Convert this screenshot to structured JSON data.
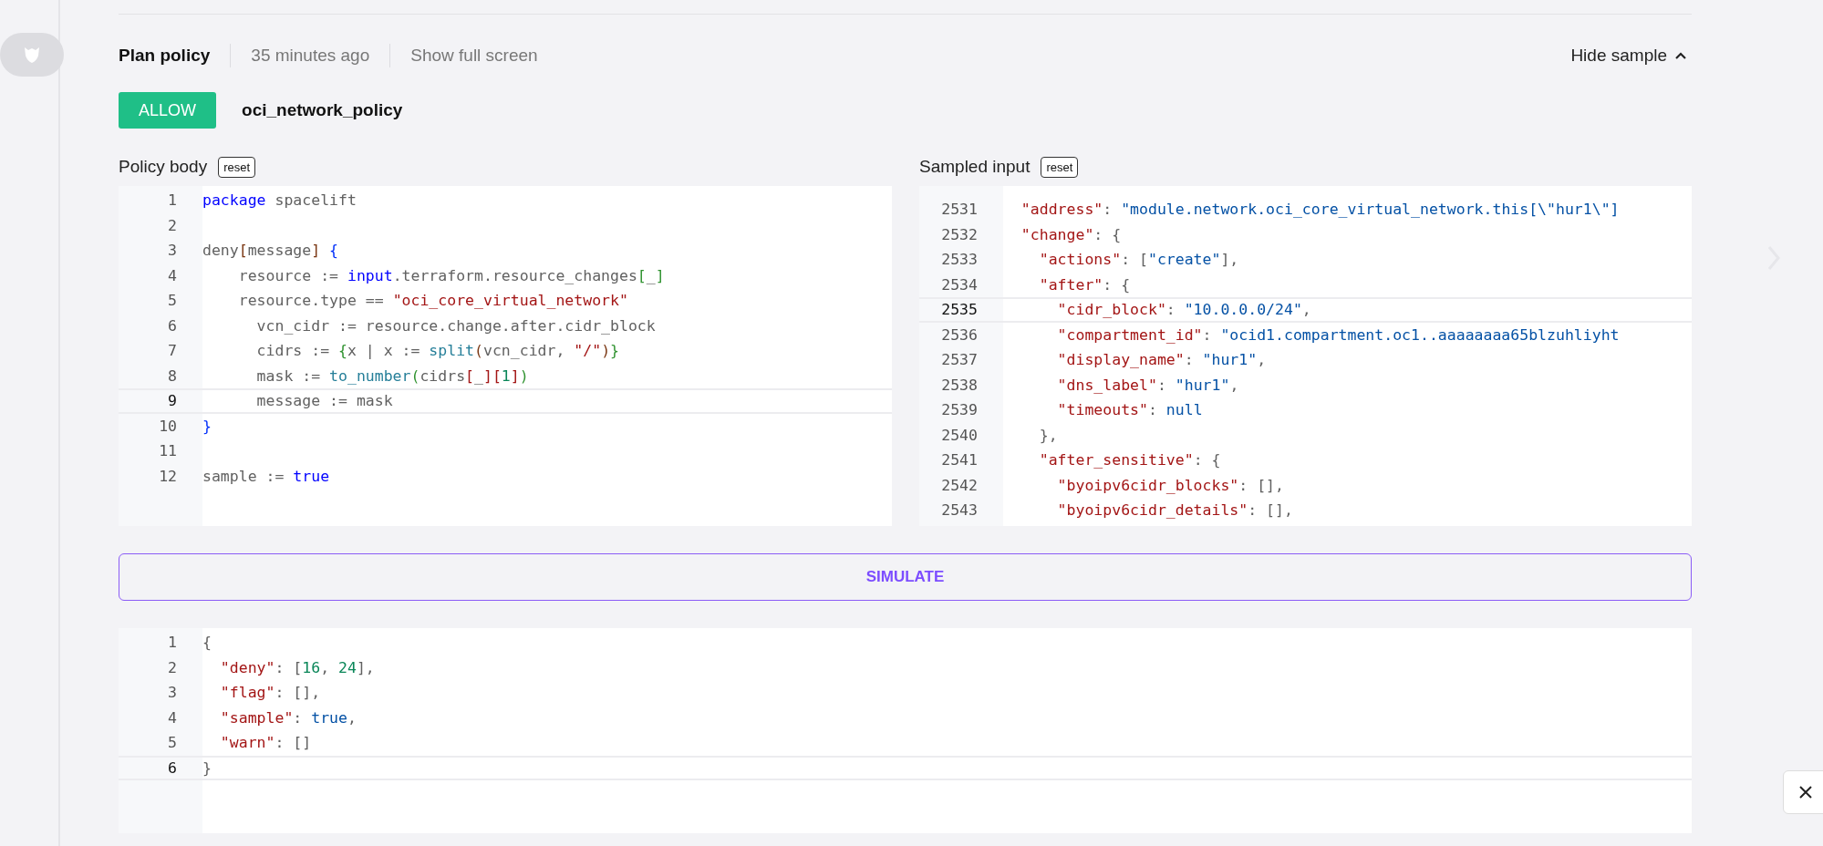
{
  "header": {
    "title": "Plan policy",
    "time": "35 minutes ago",
    "fullscreen_link": "Show full screen",
    "toggle": "Hide sample"
  },
  "decision": {
    "badge": "ALLOW",
    "policy_name": "oci_network_policy"
  },
  "policy_body": {
    "label": "Policy body",
    "reset": "reset",
    "lines": [
      {
        "n": "1",
        "active": false,
        "tokens": [
          {
            "kind": "kw",
            "text": "package"
          },
          {
            "kind": "plain",
            "text": " spacelift"
          }
        ]
      },
      {
        "n": "2",
        "active": false
      },
      {
        "n": "3",
        "active": false,
        "tokens": [
          {
            "kind": "plain",
            "text": "deny"
          },
          {
            "kind": "br3",
            "text": "["
          },
          {
            "kind": "plain",
            "text": "message"
          },
          {
            "kind": "br3",
            "text": "]"
          },
          {
            "kind": "br1",
            "text": " {"
          }
        ]
      },
      {
        "n": "4",
        "active": false,
        "tokens": [
          {
            "kind": "plain",
            "text": "    resource := "
          },
          {
            "kind": "kw",
            "text": "input"
          },
          {
            "kind": "plain",
            "text": ".terraform.resource_changes"
          },
          {
            "kind": "br2",
            "text": "["
          },
          {
            "kind": "plain",
            "text": "_"
          },
          {
            "kind": "br2",
            "text": "]"
          }
        ]
      },
      {
        "n": "5",
        "active": false,
        "tokens": [
          {
            "kind": "plain",
            "text": "    resource.type == "
          },
          {
            "kind": "str",
            "text": "\"oci_core_virtual_network\""
          }
        ]
      },
      {
        "n": "6",
        "active": false,
        "tokens": [
          {
            "kind": "plain",
            "text": "      vcn_cidr := resource.change.after.cidr_block"
          }
        ]
      },
      {
        "n": "7",
        "active": false,
        "tokens": [
          {
            "kind": "plain",
            "text": "      cidrs := "
          },
          {
            "kind": "br2",
            "text": "{"
          },
          {
            "kind": "plain",
            "text": "x | x := "
          },
          {
            "kind": "fn",
            "text": "split"
          },
          {
            "kind": "br3",
            "text": "("
          },
          {
            "kind": "plain",
            "text": "vcn_cidr, "
          },
          {
            "kind": "str",
            "text": "\"/\""
          },
          {
            "kind": "br3",
            "text": ")"
          },
          {
            "kind": "br2",
            "text": "}"
          }
        ]
      },
      {
        "n": "8",
        "active": false,
        "tokens": [
          {
            "kind": "plain",
            "text": "      mask := "
          },
          {
            "kind": "fn",
            "text": "to_number"
          },
          {
            "kind": "br2",
            "text": "("
          },
          {
            "kind": "plain",
            "text": "cidrs"
          },
          {
            "kind": "str",
            "text": "["
          },
          {
            "kind": "plain",
            "text": "_"
          },
          {
            "kind": "str",
            "text": "]["
          },
          {
            "kind": "num",
            "text": "1"
          },
          {
            "kind": "str",
            "text": "]"
          },
          {
            "kind": "br2",
            "text": ")"
          }
        ]
      },
      {
        "n": "9",
        "active": true,
        "tokens": [
          {
            "kind": "plain",
            "text": "      message := mask"
          }
        ]
      },
      {
        "n": "10",
        "active": false,
        "tokens": [
          {
            "kind": "br1",
            "text": "}"
          }
        ]
      },
      {
        "n": "11",
        "active": false
      },
      {
        "n": "12",
        "active": false,
        "tokens": [
          {
            "kind": "plain",
            "text": "sample := "
          },
          {
            "kind": "kw",
            "text": "true"
          }
        ]
      }
    ]
  },
  "sampled_input": {
    "label": "Sampled input",
    "reset": "reset",
    "lines": [
      {
        "n": "2531",
        "active": false,
        "tokens": [
          {
            "kind": "key",
            "text": "  \"address\""
          },
          {
            "kind": "plain",
            "text": ": "
          },
          {
            "kind": "val",
            "text": "\"module.network.oci_core_virtual_network.this[\\\"hur1\\\"]"
          }
        ]
      },
      {
        "n": "2532",
        "active": false,
        "tokens": [
          {
            "kind": "key",
            "text": "  \"change\""
          },
          {
            "kind": "plain",
            "text": ": {"
          }
        ]
      },
      {
        "n": "2533",
        "active": false,
        "tokens": [
          {
            "kind": "key",
            "text": "    \"actions\""
          },
          {
            "kind": "plain",
            "text": ": ["
          },
          {
            "kind": "val",
            "text": "\"create\""
          },
          {
            "kind": "plain",
            "text": "],"
          }
        ]
      },
      {
        "n": "2534",
        "active": false,
        "tokens": [
          {
            "kind": "key",
            "text": "    \"after\""
          },
          {
            "kind": "plain",
            "text": ": {"
          }
        ]
      },
      {
        "n": "2535",
        "active": true,
        "tokens": [
          {
            "kind": "key",
            "text": "      \"cidr_block\""
          },
          {
            "kind": "plain",
            "text": ": "
          },
          {
            "kind": "val",
            "text": "\"10.0.0.0/24\""
          },
          {
            "kind": "plain",
            "text": ","
          }
        ]
      },
      {
        "n": "2536",
        "active": false,
        "tokens": [
          {
            "kind": "key",
            "text": "      \"compartment_id\""
          },
          {
            "kind": "plain",
            "text": ": "
          },
          {
            "kind": "val",
            "text": "\"ocid1.compartment.oc1..aaaaaaaa65blzuhliyht"
          }
        ]
      },
      {
        "n": "2537",
        "active": false,
        "tokens": [
          {
            "kind": "key",
            "text": "      \"display_name\""
          },
          {
            "kind": "plain",
            "text": ": "
          },
          {
            "kind": "val",
            "text": "\"hur1\""
          },
          {
            "kind": "plain",
            "text": ","
          }
        ]
      },
      {
        "n": "2538",
        "active": false,
        "tokens": [
          {
            "kind": "key",
            "text": "      \"dns_label\""
          },
          {
            "kind": "plain",
            "text": ": "
          },
          {
            "kind": "val",
            "text": "\"hur1\""
          },
          {
            "kind": "plain",
            "text": ","
          }
        ]
      },
      {
        "n": "2539",
        "active": false,
        "tokens": [
          {
            "kind": "key",
            "text": "      \"timeouts\""
          },
          {
            "kind": "plain",
            "text": ": "
          },
          {
            "kind": "val",
            "text": "null"
          }
        ]
      },
      {
        "n": "2540",
        "active": false,
        "tokens": [
          {
            "kind": "plain",
            "text": "    },"
          }
        ]
      },
      {
        "n": "2541",
        "active": false,
        "tokens": [
          {
            "kind": "key",
            "text": "    \"after_sensitive\""
          },
          {
            "kind": "plain",
            "text": ": {"
          }
        ]
      },
      {
        "n": "2542",
        "active": false,
        "tokens": [
          {
            "kind": "key",
            "text": "      \"byoipv6cidr_blocks\""
          },
          {
            "kind": "plain",
            "text": ": [],"
          }
        ]
      },
      {
        "n": "2543",
        "active": false,
        "tokens": [
          {
            "kind": "key",
            "text": "      \"byoipv6cidr_details\""
          },
          {
            "kind": "plain",
            "text": ": [],"
          }
        ]
      }
    ]
  },
  "simulate": "SIMULATE",
  "output": {
    "lines": [
      {
        "n": "1",
        "active": false,
        "tokens": [
          {
            "kind": "plain",
            "text": "{"
          }
        ]
      },
      {
        "n": "2",
        "active": false,
        "tokens": [
          {
            "kind": "key",
            "text": "  \"deny\""
          },
          {
            "kind": "plain",
            "text": ": ["
          },
          {
            "kind": "num",
            "text": "16"
          },
          {
            "kind": "plain",
            "text": ", "
          },
          {
            "kind": "num",
            "text": "24"
          },
          {
            "kind": "plain",
            "text": "],"
          }
        ]
      },
      {
        "n": "3",
        "active": false,
        "tokens": [
          {
            "kind": "key",
            "text": "  \"flag\""
          },
          {
            "kind": "plain",
            "text": ": [],"
          }
        ]
      },
      {
        "n": "4",
        "active": false,
        "tokens": [
          {
            "kind": "key",
            "text": "  \"sample\""
          },
          {
            "kind": "plain",
            "text": ": "
          },
          {
            "kind": "val",
            "text": "true"
          },
          {
            "kind": "plain",
            "text": ","
          }
        ]
      },
      {
        "n": "5",
        "active": false,
        "tokens": [
          {
            "kind": "key",
            "text": "  \"warn\""
          },
          {
            "kind": "plain",
            "text": ": []"
          }
        ]
      },
      {
        "n": "6",
        "active": true,
        "tokens": [
          {
            "kind": "plain",
            "text": "}"
          }
        ]
      }
    ]
  }
}
